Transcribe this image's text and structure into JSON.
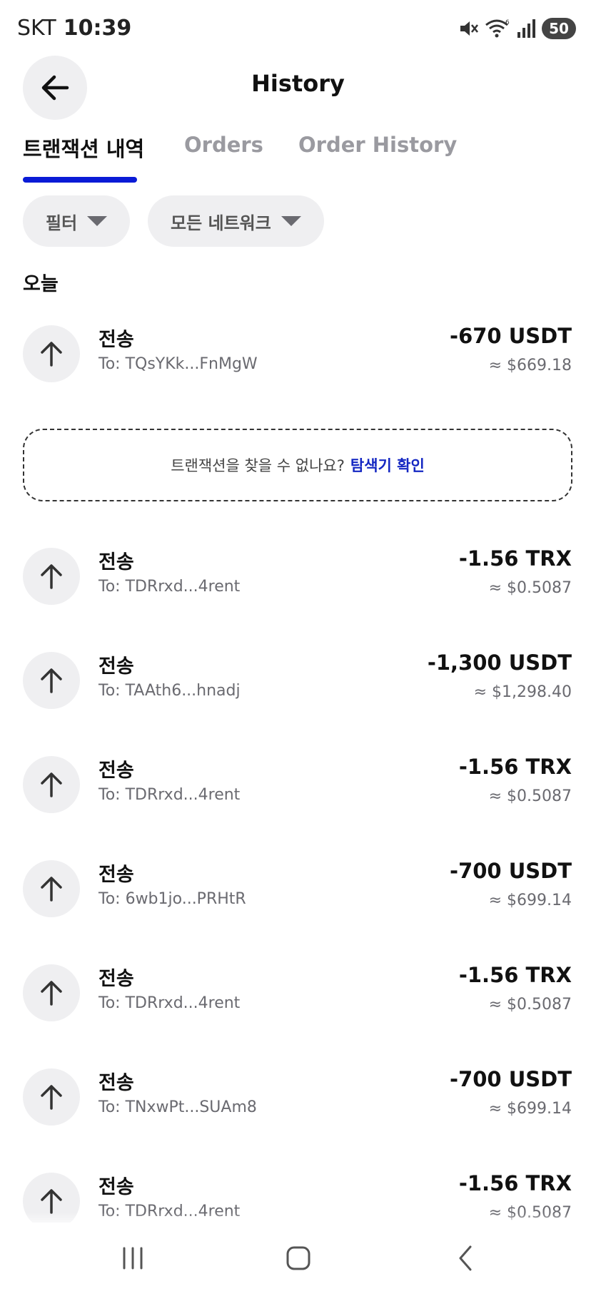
{
  "status_bar": {
    "carrier": "SKT",
    "time": "10:39",
    "wifi_badge": "6",
    "battery": "50"
  },
  "header": {
    "title": "History"
  },
  "tabs": [
    {
      "label": "트랜잭션 내역",
      "active": true
    },
    {
      "label": "Orders",
      "active": false
    },
    {
      "label": "Order History",
      "active": false
    }
  ],
  "filters": {
    "filter_label": "필터",
    "network_label": "모든 네트워크"
  },
  "section": {
    "today": "오늘"
  },
  "explorer_prompt": {
    "text": "트랜잭션을 찾을 수 없나요?",
    "link": "탐색기 확인"
  },
  "transactions": [
    {
      "type": "전송",
      "address": "To: TQsYKk...FnMgW",
      "amount": "-670 USDT",
      "fiat": "≈ $669.18"
    },
    {
      "type": "전송",
      "address": "To: TDRrxd...4rent",
      "amount": "-1.56 TRX",
      "fiat": "≈ $0.5087"
    },
    {
      "type": "전송",
      "address": "To: TAAth6...hnadj",
      "amount": "-1,300 USDT",
      "fiat": "≈ $1,298.40"
    },
    {
      "type": "전송",
      "address": "To: TDRrxd...4rent",
      "amount": "-1.56 TRX",
      "fiat": "≈ $0.5087"
    },
    {
      "type": "전송",
      "address": "To: 6wb1jo...PRHtR",
      "amount": "-700 USDT",
      "fiat": "≈ $699.14"
    },
    {
      "type": "전송",
      "address": "To: TDRrxd...4rent",
      "amount": "-1.56 TRX",
      "fiat": "≈ $0.5087"
    },
    {
      "type": "전송",
      "address": "To: TNxwPt...SUAm8",
      "amount": "-700 USDT",
      "fiat": "≈ $699.14"
    },
    {
      "type": "전송",
      "address": "To: TDRrxd...4rent",
      "amount": "-1.56 TRX",
      "fiat": "≈ $0.5087"
    }
  ],
  "colors": {
    "accent": "#0a1bd6",
    "link": "#1427c2",
    "chip_bg": "#efeff1",
    "muted_text": "#6a6a70"
  },
  "icons": {
    "back": "arrow-left-icon",
    "send": "arrow-up-icon",
    "mute": "mute-icon",
    "wifi": "wifi-icon",
    "signal": "signal-icon",
    "recents": "recents-icon",
    "home": "home-icon",
    "nav_back": "chevron-left-icon"
  }
}
